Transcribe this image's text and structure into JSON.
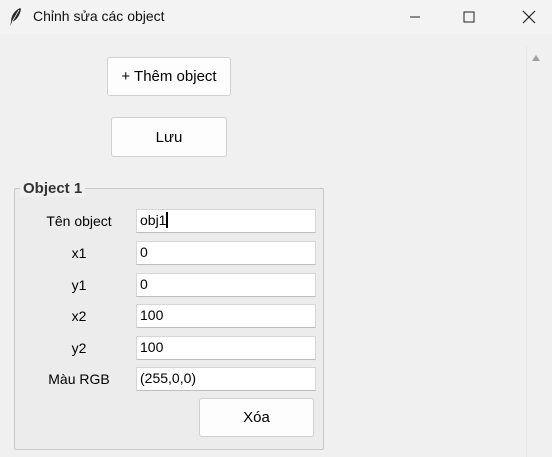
{
  "window": {
    "title": "Chỉnh sửa các object",
    "app_icon": "feather-icon",
    "controls": [
      "minimize-icon",
      "maximize-icon",
      "close-icon"
    ]
  },
  "toolbar": {
    "add_label": "+ Thêm object",
    "save_label": "Lưu"
  },
  "objects": [
    {
      "group_title": "Object 1",
      "fields": {
        "name": {
          "label": "Tên object",
          "value": "obj1"
        },
        "x1": {
          "label": "x1",
          "value": "0"
        },
        "y1": {
          "label": "y1",
          "value": "0"
        },
        "x2": {
          "label": "x2",
          "value": "100"
        },
        "y2": {
          "label": "y2",
          "value": "100"
        },
        "rgb": {
          "label": "Màu RGB",
          "value": "(255,0,0)"
        }
      },
      "delete_label": "Xóa"
    }
  ],
  "colors": {
    "background": "#f0f0f0",
    "titlebar": "#f3f3f3",
    "field_bg": "#ffffff",
    "border": "#d0d0d0"
  }
}
